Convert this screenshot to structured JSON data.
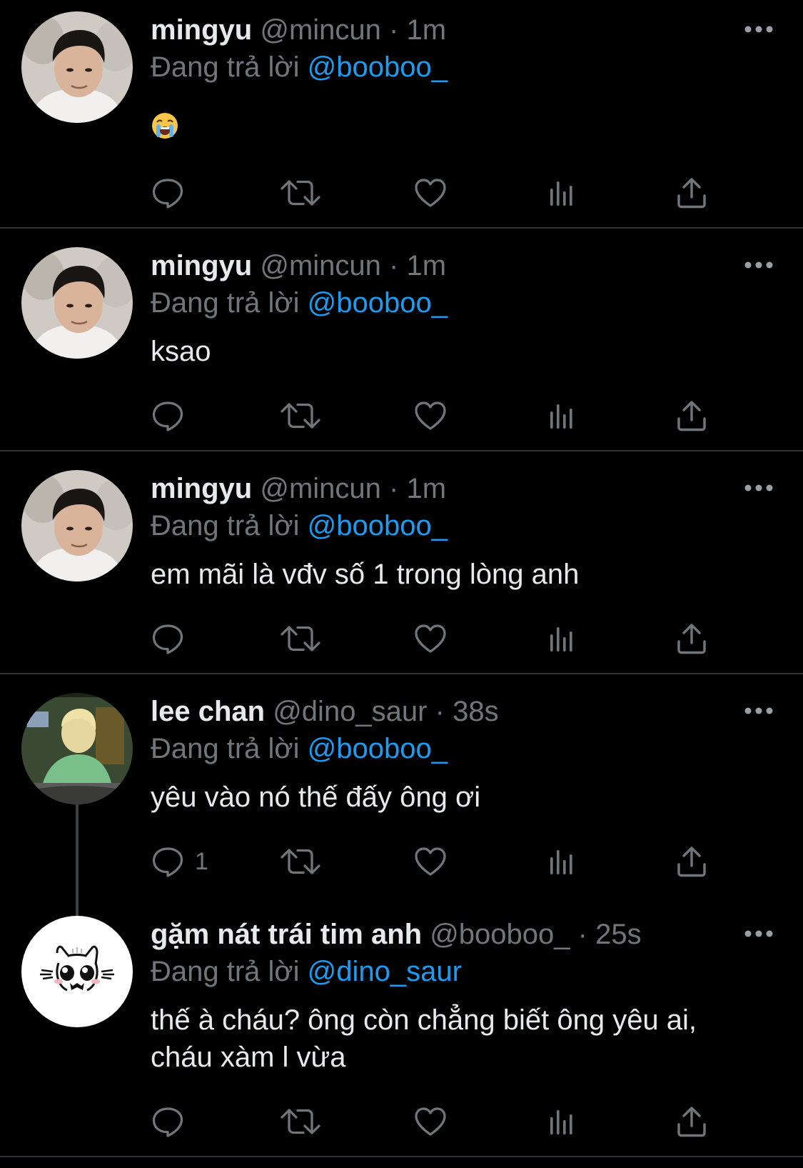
{
  "tweets": [
    {
      "name": "mingyu",
      "handle": "@mincun",
      "sep": "·",
      "time": "1m",
      "reply_prefix": "Đang trả lời",
      "reply_to": "@booboo_",
      "text": "",
      "emoji": "loudly-crying-face-emoji",
      "reply_count": ""
    },
    {
      "name": "mingyu",
      "handle": "@mincun",
      "sep": "·",
      "time": "1m",
      "reply_prefix": "Đang trả lời",
      "reply_to": "@booboo_",
      "text": "ksao",
      "reply_count": ""
    },
    {
      "name": "mingyu",
      "handle": "@mincun",
      "sep": "·",
      "time": "1m",
      "reply_prefix": "Đang trả lời",
      "reply_to": "@booboo_",
      "text": "em mãi là vđv số 1 trong lòng anh",
      "reply_count": ""
    },
    {
      "name": "lee chan",
      "handle": "@dino_saur",
      "sep": "·",
      "time": "38s",
      "reply_prefix": "Đang trả lời",
      "reply_to": "@booboo_",
      "text": "yêu vào nó thế đấy ông ơi",
      "reply_count": "1"
    },
    {
      "name": "gặm nát trái tim anh",
      "handle": "@booboo_",
      "sep": "·",
      "time": "25s",
      "reply_prefix": "Đang trả lời",
      "reply_to": "@dino_saur",
      "text_line1": "thế à cháu? ông còn chẳng biết ông yêu ai,",
      "text_line2": "cháu xàm l vừa",
      "reply_count": ""
    }
  ],
  "icons": {
    "reply": "reply-icon",
    "retweet": "retweet-icon",
    "like": "heart-icon",
    "views": "views-icon",
    "share": "share-icon",
    "more": "more-icon"
  },
  "colors": {
    "background": "#000000",
    "text": "#e7e9ea",
    "muted": "#71767b",
    "link": "#1d9bf0",
    "divider": "#2f3336"
  }
}
